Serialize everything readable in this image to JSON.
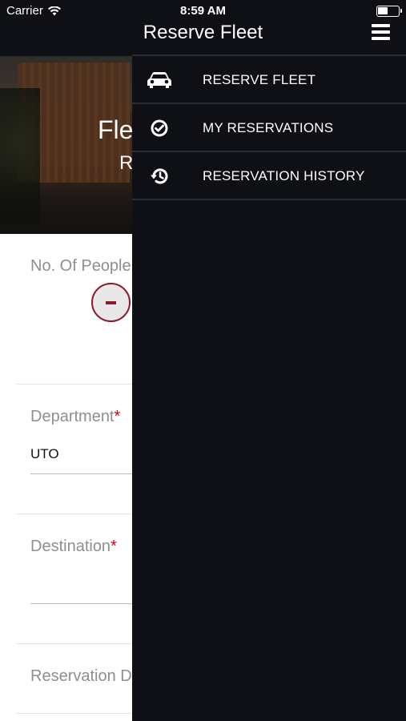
{
  "status_bar": {
    "carrier": "Carrier",
    "time": "8:59 AM"
  },
  "header": {
    "title": "Reserve Fleet",
    "menu_icon": "hamburger-icon"
  },
  "hero": {
    "title_partial": "Fle",
    "subtitle_partial": "R"
  },
  "form": {
    "people_label": "No. Of People",
    "department_label": "Department",
    "department_value": "UTO",
    "destination_label": "Destination",
    "reservation_date_label": "Reservation D",
    "required_mark": "*"
  },
  "drawer": {
    "items": [
      {
        "label": "RESERVE FLEET",
        "icon": "car-icon"
      },
      {
        "label": "MY RESERVATIONS",
        "icon": "check-circle-icon"
      },
      {
        "label": "RESERVATION HISTORY",
        "icon": "history-icon"
      }
    ]
  },
  "colors": {
    "bar_bg": "#0e1015",
    "accent": "#8b1a2e",
    "required": "#d0021b",
    "label_grey": "#8e8e93"
  }
}
